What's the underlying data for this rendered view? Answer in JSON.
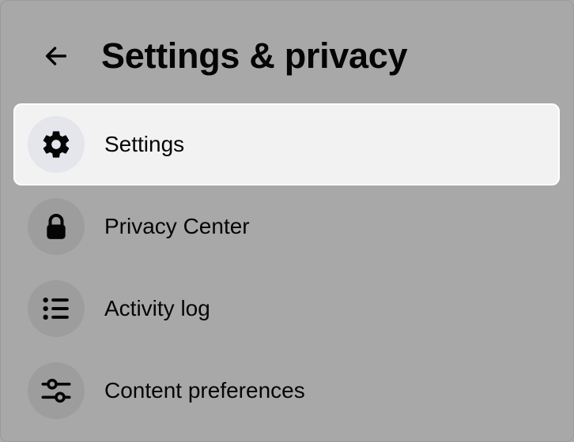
{
  "header": {
    "title": "Settings & privacy",
    "back_icon": "arrow-left-icon"
  },
  "menu": {
    "items": [
      {
        "label": "Settings",
        "icon": "gear-icon",
        "active": true
      },
      {
        "label": "Privacy Center",
        "icon": "lock-icon",
        "active": false
      },
      {
        "label": "Activity log",
        "icon": "list-icon",
        "active": false
      },
      {
        "label": "Content preferences",
        "icon": "sliders-icon",
        "active": false
      }
    ]
  },
  "colors": {
    "overlay_background": "#a8a8a8",
    "active_item_background": "#f2f2f2",
    "icon_circle_background": "#9d9d9d",
    "active_icon_circle_background": "#e4e6eb",
    "text": "#050505"
  }
}
